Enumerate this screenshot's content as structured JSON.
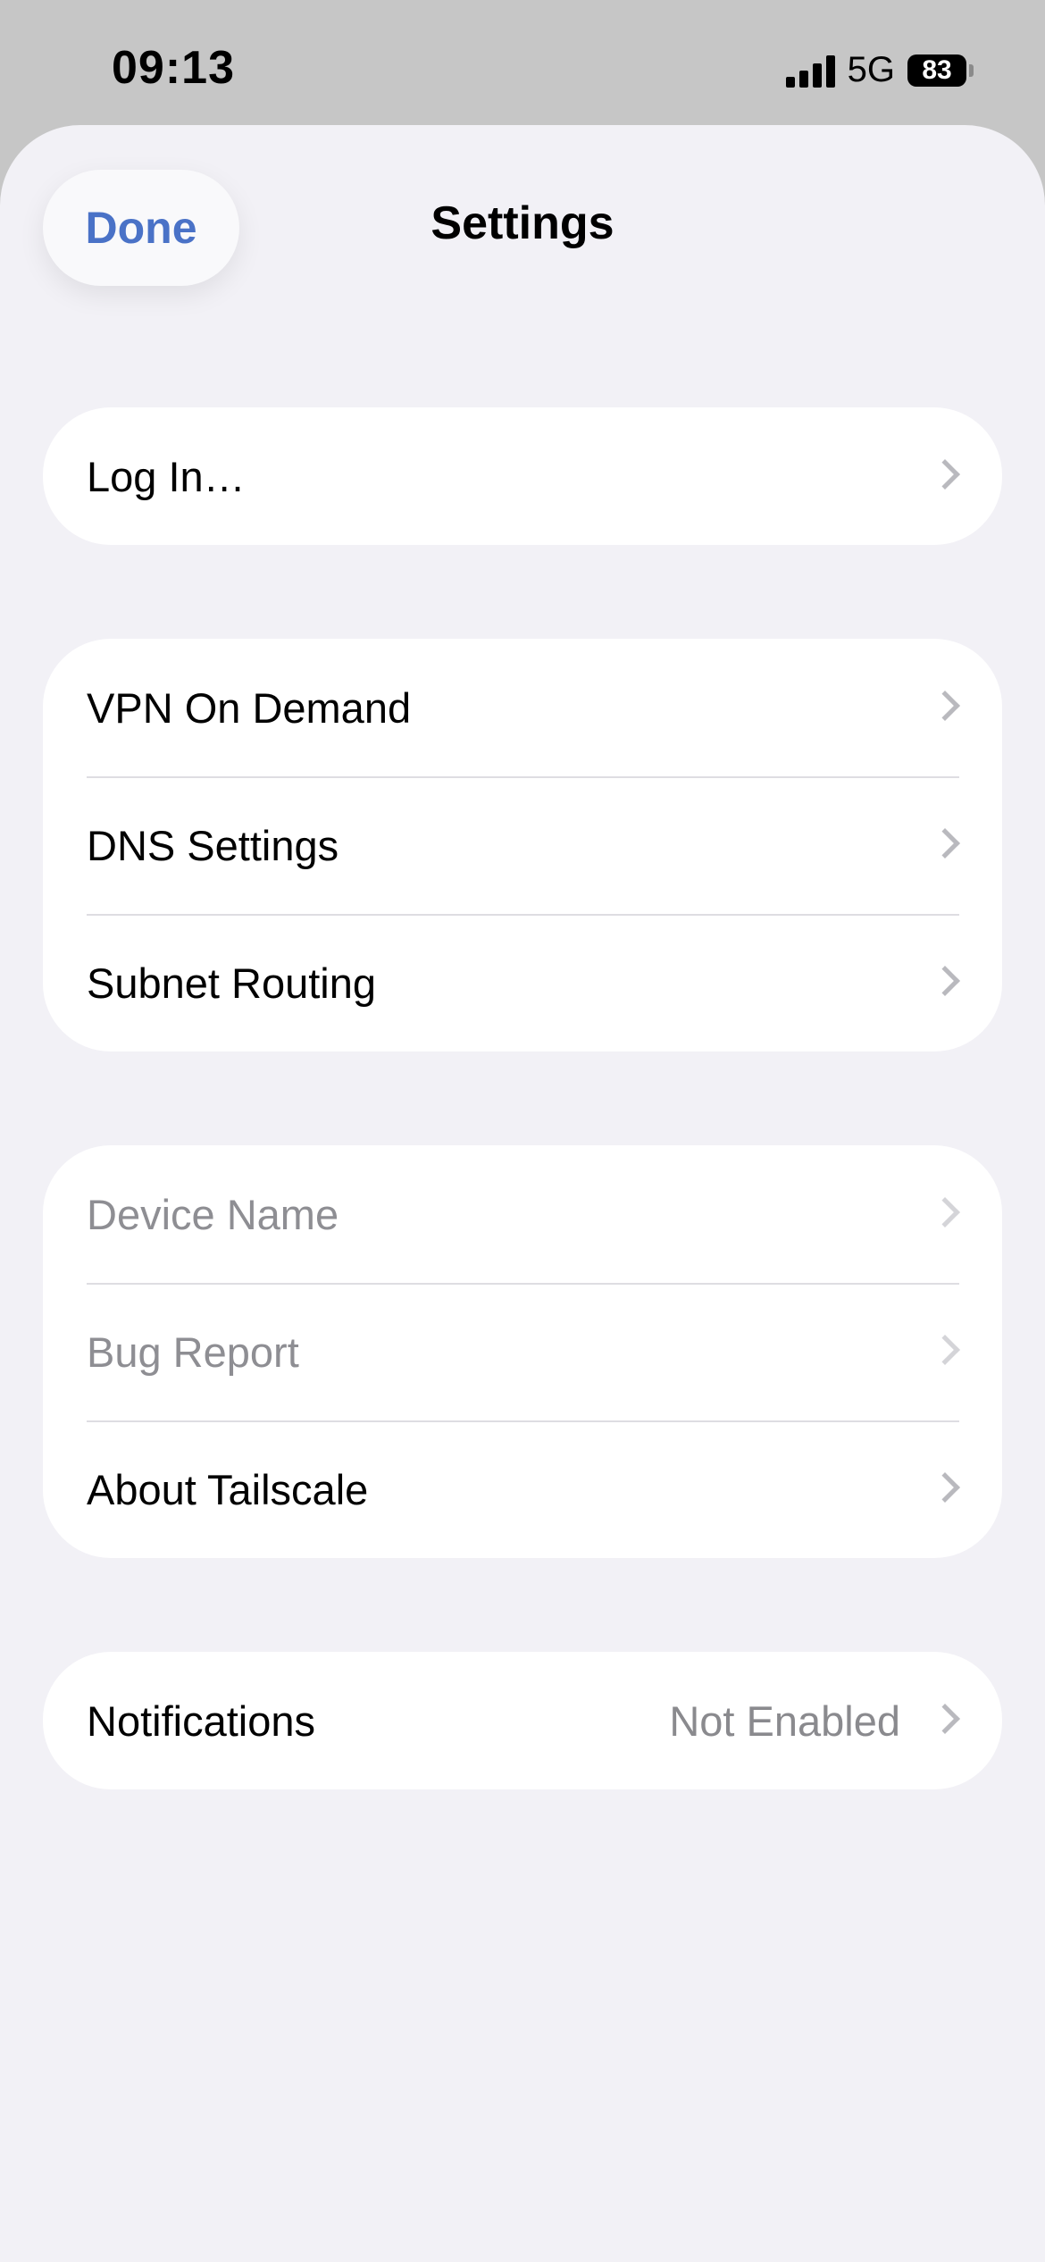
{
  "status_bar": {
    "time": "09:13",
    "network": "5G",
    "battery": "83"
  },
  "header": {
    "done_label": "Done",
    "title": "Settings"
  },
  "groups": [
    {
      "rows": [
        {
          "label": "Log In…",
          "enabled": true
        }
      ]
    },
    {
      "rows": [
        {
          "label": "VPN On Demand",
          "enabled": true
        },
        {
          "label": "DNS Settings",
          "enabled": true
        },
        {
          "label": "Subnet Routing",
          "enabled": true
        }
      ]
    },
    {
      "rows": [
        {
          "label": "Device Name",
          "enabled": false
        },
        {
          "label": "Bug Report",
          "enabled": false
        },
        {
          "label": "About Tailscale",
          "enabled": true
        }
      ]
    },
    {
      "rows": [
        {
          "label": "Notifications",
          "value": "Not Enabled",
          "enabled": true
        }
      ]
    }
  ],
  "colors": {
    "accent": "#4a72c7",
    "background": "#f2f1f6",
    "status_bar_bg": "#c6c6c6",
    "disabled_text": "#8e8e93"
  },
  "icons": [
    "signal-bars-icon",
    "battery-icon",
    "chevron-right-icon"
  ]
}
